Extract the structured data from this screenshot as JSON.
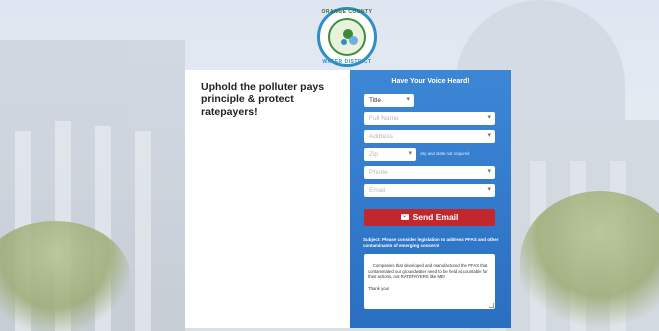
{
  "logo": {
    "text_top": "ORANGE COUNTY",
    "text_bottom": "WATER DISTRICT",
    "icon": "water-district-seal"
  },
  "headline": "Uphold the polluter pays principle & protect ratepayers!",
  "form": {
    "title": "Have Your Voice Heard!",
    "title_select": {
      "value": "Title"
    },
    "full_name": {
      "placeholder": "Full Name"
    },
    "address": {
      "placeholder": "Address"
    },
    "zip": {
      "placeholder": "Zip"
    },
    "zip_note": "city and state not required",
    "phone": {
      "placeholder": "Phone"
    },
    "email": {
      "placeholder": "Email"
    },
    "send_button": {
      "label": "Send Email",
      "icon": "envelope-icon"
    },
    "subject": "Subject: Please consider legislation to address PFAS and other contaminants of emerging concern!",
    "message": "Companies that developed and manufactured the PFAS that contaminated our groundwater need to be held accountable for their actions, not RATEPAYERS like ME!\n\nThank you!"
  },
  "colors": {
    "form_blue": "#2f76c8",
    "send_red": "#c2272d",
    "logo_blue": "#2e8ec6",
    "logo_green": "#3f8f3f"
  }
}
